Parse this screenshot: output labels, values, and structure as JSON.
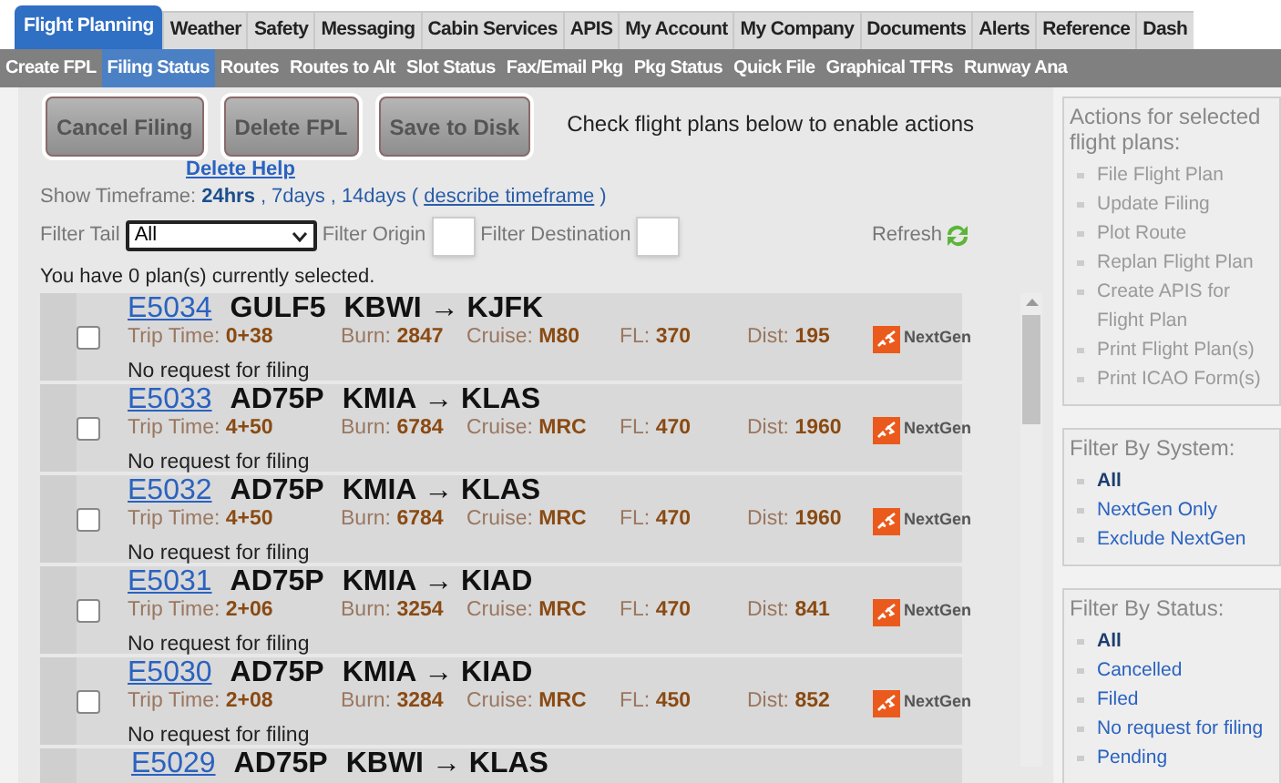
{
  "main_tabs": [
    {
      "label": "Flight Planning",
      "selected": true
    },
    {
      "label": "Weather",
      "selected": false
    },
    {
      "label": "Safety",
      "selected": false
    },
    {
      "label": "Messaging",
      "selected": false
    },
    {
      "label": "Cabin Services",
      "selected": false
    },
    {
      "label": "APIS",
      "selected": false
    },
    {
      "label": "My Account",
      "selected": false
    },
    {
      "label": "My Company",
      "selected": false
    },
    {
      "label": "Documents",
      "selected": false
    },
    {
      "label": "Alerts",
      "selected": false
    },
    {
      "label": "Reference",
      "selected": false
    },
    {
      "label": "Dash",
      "selected": false
    }
  ],
  "sub_tabs": [
    {
      "label": "Create FPL",
      "selected": false
    },
    {
      "label": "Filing Status",
      "selected": true
    },
    {
      "label": "Routes",
      "selected": false
    },
    {
      "label": "Routes to Alt",
      "selected": false
    },
    {
      "label": "Slot Status",
      "selected": false
    },
    {
      "label": "Fax/Email Pkg",
      "selected": false
    },
    {
      "label": "Pkg Status",
      "selected": false
    },
    {
      "label": "Quick File",
      "selected": false
    },
    {
      "label": "Graphical TFRs",
      "selected": false
    },
    {
      "label": "Runway Ana",
      "selected": false
    }
  ],
  "action_buttons": [
    {
      "label": "Cancel Filing",
      "disabled": true
    },
    {
      "label": "Delete FPL",
      "disabled": true
    },
    {
      "label": "Save to Disk",
      "disabled": true
    }
  ],
  "actions_hint": "Check flight plans below to enable actions",
  "delete_help": "Delete Help",
  "timeframe": {
    "label": "Show Timeframe:",
    "options": [
      {
        "label": "24hrs",
        "selected": true,
        "separator": ","
      },
      {
        "label": "7days",
        "selected": false,
        "separator": ","
      },
      {
        "label": "14days",
        "selected": false
      }
    ],
    "open_paren": "(",
    "describe": "describe timeframe",
    "close_paren": ")"
  },
  "filters": {
    "tail_label": "Filter Tail",
    "tail_value": "All",
    "origin_label": "Filter Origin",
    "destination_label": "Filter Destination",
    "refresh": "Refresh"
  },
  "selection_status": "You have 0 plan(s) currently selected.",
  "plans": [
    {
      "id": "E5034",
      "aircraft": "GULF5",
      "route": "KBWI → KJFK",
      "fields": [
        {
          "label": "Trip Time:",
          "value": "0+38"
        },
        {
          "label": "Burn:",
          "value": "2847"
        },
        {
          "label": "Cruise:",
          "value": "M80"
        },
        {
          "label": "FL:",
          "value": "370"
        },
        {
          "label": "Dist:",
          "value": "195"
        }
      ],
      "system": "NextGen",
      "status": "No request for filing",
      "checked": false
    },
    {
      "id": "E5033",
      "aircraft": "AD75P",
      "route": "KMIA → KLAS",
      "fields": [
        {
          "label": "Trip Time:",
          "value": "4+50"
        },
        {
          "label": "Burn:",
          "value": "6784"
        },
        {
          "label": "Cruise:",
          "value": "MRC"
        },
        {
          "label": "FL:",
          "value": "470"
        },
        {
          "label": "Dist:",
          "value": "1960"
        }
      ],
      "system": "NextGen",
      "status": "No request for filing",
      "checked": false
    },
    {
      "id": "E5032",
      "aircraft": "AD75P",
      "route": "KMIA → KLAS",
      "fields": [
        {
          "label": "Trip Time:",
          "value": "4+50"
        },
        {
          "label": "Burn:",
          "value": "6784"
        },
        {
          "label": "Cruise:",
          "value": "MRC"
        },
        {
          "label": "FL:",
          "value": "470"
        },
        {
          "label": "Dist:",
          "value": "1960"
        }
      ],
      "system": "NextGen",
      "status": "No request for filing",
      "checked": false
    },
    {
      "id": "E5031",
      "aircraft": "AD75P",
      "route": "KMIA → KIAD",
      "fields": [
        {
          "label": "Trip Time:",
          "value": "2+06"
        },
        {
          "label": "Burn:",
          "value": "3254"
        },
        {
          "label": "Cruise:",
          "value": "MRC"
        },
        {
          "label": "FL:",
          "value": "470"
        },
        {
          "label": "Dist:",
          "value": "841"
        }
      ],
      "system": "NextGen",
      "status": "No request for filing",
      "checked": false
    },
    {
      "id": "E5030",
      "aircraft": "AD75P",
      "route": "KMIA → KIAD",
      "fields": [
        {
          "label": "Trip Time:",
          "value": "2+08"
        },
        {
          "label": "Burn:",
          "value": "3284"
        },
        {
          "label": "Cruise:",
          "value": "MRC"
        },
        {
          "label": "FL:",
          "value": "450"
        },
        {
          "label": "Dist:",
          "value": "852"
        }
      ],
      "system": "NextGen",
      "status": "No request for filing",
      "checked": false
    },
    {
      "id": "E5029",
      "aircraft": "AD75P",
      "route": "KBWI → KLAS"
    }
  ],
  "sidebar": {
    "actions": {
      "title": "Actions for selected flight plans:",
      "items": [
        {
          "label": "File Flight Plan",
          "disabled": true
        },
        {
          "label": "Update Filing",
          "disabled": true
        },
        {
          "label": "Plot Route",
          "disabled": true
        },
        {
          "label": "Replan Flight Plan",
          "disabled": true
        },
        {
          "label": "Create APIS for Flight Plan",
          "disabled": true
        },
        {
          "label": "Print Flight Plan(s)",
          "disabled": true
        },
        {
          "label": "Print ICAO Form(s)",
          "disabled": true
        }
      ]
    },
    "filter_system": {
      "title": "Filter By System:",
      "items": [
        {
          "label": "All",
          "selected": true
        },
        {
          "label": "NextGen Only",
          "selected": false
        },
        {
          "label": "Exclude NextGen",
          "selected": false
        }
      ]
    },
    "filter_status": {
      "title": "Filter By Status:",
      "items": [
        {
          "label": "All",
          "selected": true
        },
        {
          "label": "Cancelled",
          "selected": false
        },
        {
          "label": "Filed",
          "selected": false
        },
        {
          "label": "No request for filing",
          "selected": false
        },
        {
          "label": "Pending",
          "selected": false
        }
      ]
    }
  }
}
